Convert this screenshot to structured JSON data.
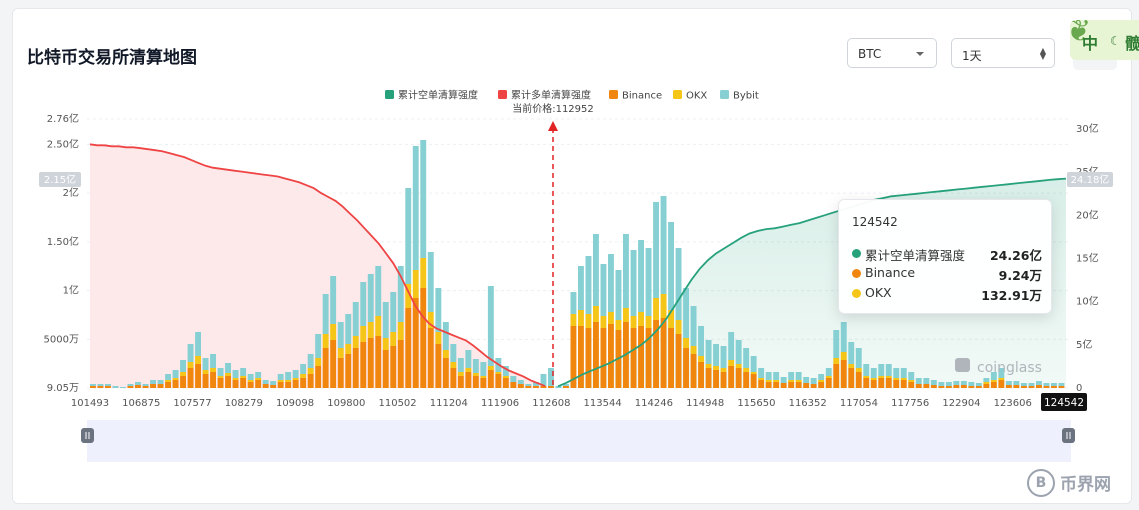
{
  "page": {
    "title": "比特币交易所清算地图",
    "coin_select": "BTC",
    "range_select": "1天",
    "corner_badge": {
      "t1": "中",
      "t3": "髋"
    },
    "bottom_watermark": {
      "text": "币界网",
      "symbol": "B"
    }
  },
  "colors": {
    "short_cum": "#26a17b",
    "long_cum": "#ef4444",
    "binance": "#f0860e",
    "okx": "#f5c518",
    "bybit": "#86d0d3",
    "current_line": "#e02424"
  },
  "chart_data": {
    "type": "bar",
    "title": "",
    "legend": [
      "累计空单清算强度",
      "累计多单清算强度",
      "Binance",
      "OKX",
      "Bybit"
    ],
    "legend_placement": "top-center",
    "current_price_label": "当前价格:112952",
    "current_price": 112952,
    "x_tick_labels": [
      "101493",
      "106875",
      "107577",
      "108279",
      "109098",
      "109800",
      "110502",
      "111204",
      "111906",
      "112608",
      "113544",
      "114246",
      "114948",
      "115650",
      "116352",
      "117054",
      "117756",
      "122904",
      "123606",
      "124542"
    ],
    "left_axis_labels": [
      "2.76亿",
      "2.50亿",
      "2亿",
      "1.50亿",
      "1亿",
      "5000万",
      "9.05万"
    ],
    "left_axis_values": [
      276000000,
      250000000,
      200000000,
      150000000,
      100000000,
      50000000,
      90500
    ],
    "right_axis_labels": [
      "30亿",
      "25亿",
      "20亿",
      "15亿",
      "10亿",
      "5亿",
      "0"
    ],
    "right_axis_values": [
      3000000000,
      2500000000,
      2000000000,
      1500000000,
      1000000000,
      500000000,
      0
    ],
    "left_marker": "2.15亿",
    "right_marker": "24.18亿",
    "crosshair_x": "124542",
    "grid": true,
    "bar_series": [
      {
        "name": "Binance",
        "values": [
          2,
          2,
          2,
          0,
          0,
          2,
          3,
          2,
          4,
          4,
          6,
          8,
          12,
          20,
          24,
          14,
          16,
          10,
          12,
          8,
          10,
          6,
          8,
          4,
          3,
          6,
          6,
          8,
          10,
          14,
          22,
          40,
          48,
          30,
          34,
          40,
          46,
          50,
          52,
          38,
          42,
          48,
          80,
          90,
          100,
          60,
          44,
          30,
          20,
          12,
          16,
          12,
          10,
          18,
          14,
          10,
          6,
          4,
          2,
          2,
          2,
          2,
          0,
          2,
          62,
          62,
          60,
          66,
          60,
          64,
          58,
          66,
          60,
          62,
          60,
          68,
          70,
          60,
          54,
          40,
          34,
          26,
          20,
          18,
          16,
          22,
          20,
          16,
          14,
          8,
          6,
          6,
          5,
          6,
          6,
          5,
          4,
          6,
          10,
          24,
          28,
          20,
          16,
          10,
          8,
          10,
          10,
          8,
          8,
          6,
          4,
          4,
          3,
          2,
          2,
          3,
          3,
          2,
          2,
          4,
          6,
          8,
          3,
          3,
          2,
          2,
          3,
          2,
          2,
          2
        ]
      },
      {
        "name": "OKX",
        "values": [
          0,
          0,
          0,
          0,
          0,
          0,
          0,
          0,
          0,
          0,
          2,
          2,
          4,
          6,
          8,
          4,
          4,
          2,
          3,
          2,
          2,
          2,
          2,
          0,
          0,
          2,
          2,
          2,
          4,
          6,
          8,
          14,
          16,
          10,
          10,
          12,
          16,
          16,
          20,
          12,
          14,
          18,
          24,
          28,
          30,
          16,
          12,
          8,
          6,
          4,
          4,
          3,
          2,
          4,
          2,
          2,
          0,
          0,
          0,
          0,
          0,
          0,
          0,
          0,
          12,
          16,
          14,
          16,
          12,
          12,
          10,
          14,
          12,
          14,
          12,
          22,
          24,
          18,
          14,
          10,
          8,
          6,
          4,
          4,
          4,
          6,
          4,
          4,
          2,
          2,
          2,
          2,
          0,
          2,
          2,
          0,
          0,
          2,
          2,
          6,
          8,
          4,
          4,
          2,
          2,
          2,
          2,
          2,
          2,
          2,
          0,
          0,
          0,
          0,
          0,
          0,
          0,
          0,
          0,
          2,
          2,
          2,
          0,
          0,
          0,
          0,
          0,
          0,
          0,
          0
        ]
      },
      {
        "name": "Bybit",
        "values": [
          2,
          2,
          2,
          2,
          1,
          2,
          3,
          2,
          4,
          4,
          6,
          8,
          12,
          18,
          24,
          12,
          14,
          8,
          10,
          8,
          8,
          6,
          6,
          4,
          4,
          6,
          8,
          8,
          10,
          14,
          24,
          40,
          48,
          26,
          30,
          34,
          44,
          48,
          50,
          36,
          40,
          56,
          96,
          124,
          118,
          60,
          44,
          28,
          18,
          14,
          18,
          14,
          14,
          80,
          14,
          10,
          6,
          4,
          2,
          4,
          12,
          18,
          2,
          2,
          22,
          44,
          58,
          72,
          52,
          58,
          50,
          74,
          66,
          72,
          68,
          96,
          98,
          88,
          72,
          50,
          40,
          30,
          24,
          22,
          22,
          28,
          24,
          20,
          16,
          10,
          8,
          8,
          6,
          8,
          8,
          6,
          6,
          6,
          8,
          28,
          30,
          22,
          20,
          12,
          10,
          12,
          12,
          10,
          10,
          8,
          6,
          6,
          5,
          4,
          4,
          4,
          4,
          4,
          3,
          4,
          8,
          10,
          4,
          4,
          3,
          3,
          4,
          3,
          3,
          3
        ]
      }
    ],
    "cumulative_long": [
      2.5,
      2.49,
      2.49,
      2.48,
      2.48,
      2.47,
      2.47,
      2.46,
      2.45,
      2.44,
      2.43,
      2.41,
      2.39,
      2.37,
      2.34,
      2.31,
      2.28,
      2.26,
      2.25,
      2.24,
      2.23,
      2.22,
      2.21,
      2.2,
      2.19,
      2.18,
      2.17,
      2.15,
      2.13,
      2.11,
      2.08,
      2.05,
      2.0,
      1.96,
      1.92,
      1.86,
      1.79,
      1.72,
      1.64,
      1.56,
      1.48,
      1.38,
      1.28,
      1.15,
      1.0,
      0.85,
      0.74,
      0.66,
      0.61,
      0.58,
      0.55,
      0.52,
      0.49,
      0.44,
      0.38,
      0.32,
      0.27,
      0.22,
      0.18,
      0.15,
      0.12,
      0.08,
      0.05,
      0.02
    ],
    "cumulative_short": [
      0.2,
      0.6,
      1.1,
      1.6,
      2.0,
      2.4,
      2.8,
      3.3,
      3.8,
      4.4,
      5.0,
      5.8,
      6.8,
      8.0,
      9.5,
      11.0,
      12.5,
      13.8,
      14.8,
      15.6,
      16.2,
      16.8,
      17.4,
      17.9,
      18.2,
      18.4,
      18.5,
      18.7,
      18.9,
      19.1,
      19.4,
      19.7,
      20.0,
      20.3,
      20.6,
      20.9,
      21.2,
      21.5,
      21.8,
      22.0,
      22.2,
      22.3,
      22.4,
      22.5,
      22.6,
      22.7,
      22.8,
      22.9,
      23.0,
      23.1,
      23.2,
      23.3,
      23.4,
      23.5,
      23.6,
      23.7,
      23.8,
      23.9,
      24.0,
      24.1,
      24.18,
      24.26
    ]
  },
  "tooltip": {
    "title": "124542",
    "rows": [
      {
        "label": "累计空单清算强度",
        "value": "24.26亿",
        "color": "#26a17b"
      },
      {
        "label": "Binance",
        "value": "9.24万",
        "color": "#f0860e"
      },
      {
        "label": "OKX",
        "value": "132.91万",
        "color": "#f5c518"
      }
    ]
  },
  "watermark": "coinglass"
}
